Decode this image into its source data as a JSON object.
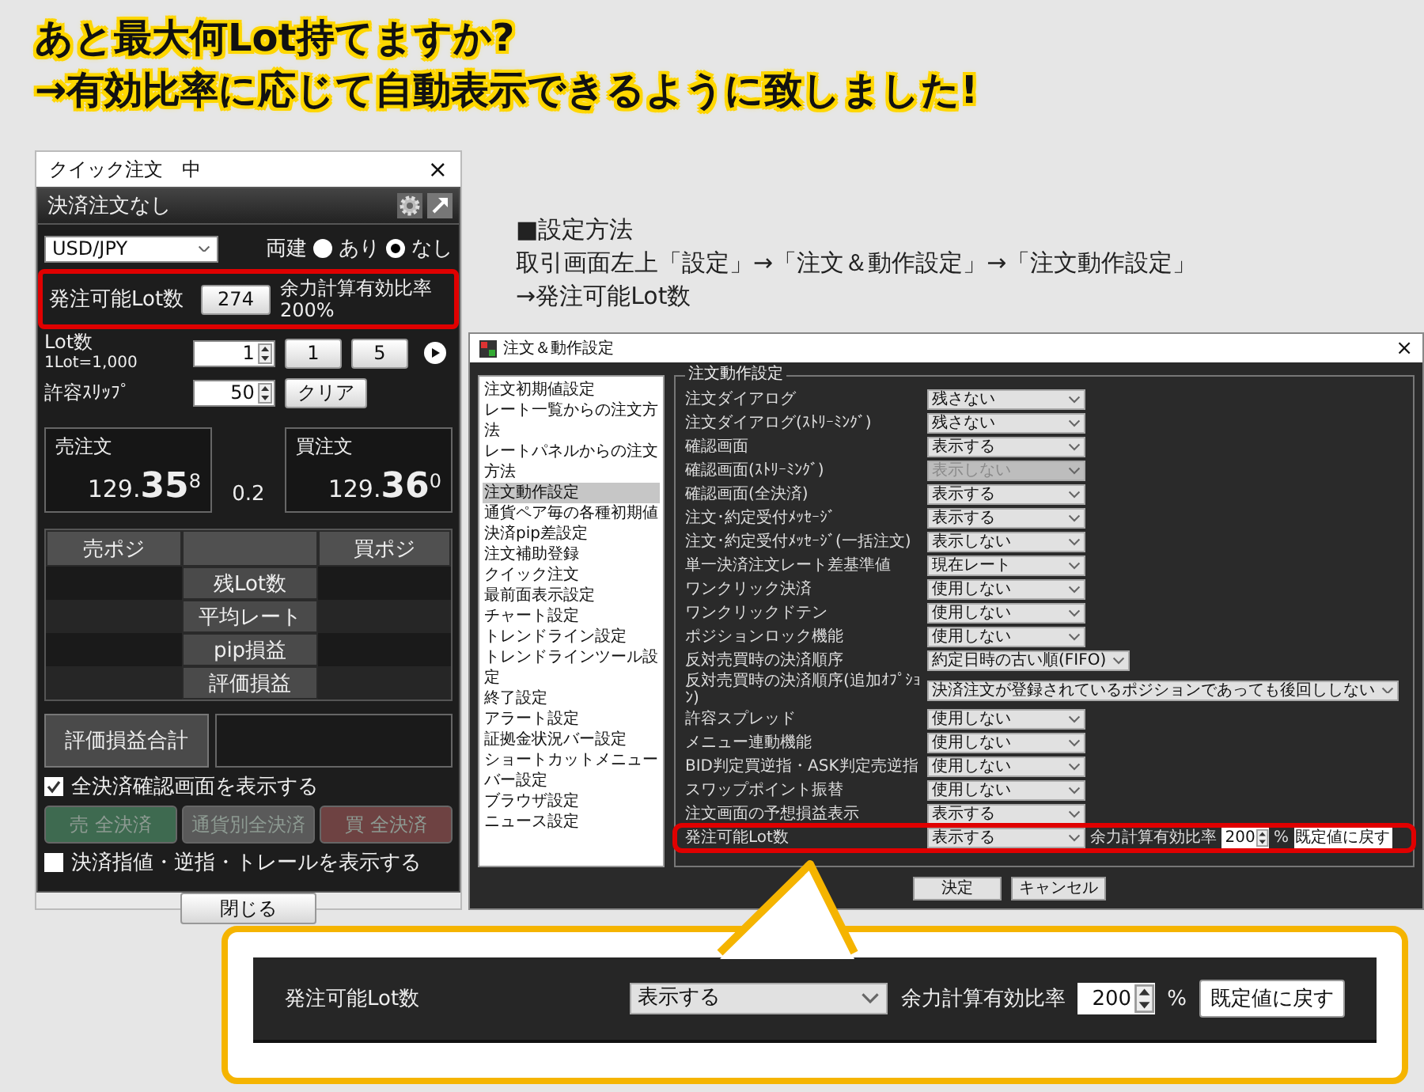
{
  "headline": {
    "lines": [
      "あと最大何Lot持てますか?",
      "→有効比率に応じて自動表示できるように致しました!"
    ]
  },
  "quick_order": {
    "title": "クイック注文　中",
    "close": "×",
    "header": "決済注文なし",
    "pair": "USD/JPY",
    "hedge": {
      "label": "両建",
      "options": [
        {
          "label": "あり",
          "selected": false
        },
        {
          "label": "なし",
          "selected": true
        }
      ]
    },
    "available_lots": {
      "label": "発注可能Lot数",
      "value": "274",
      "ratio_label": "余力計算有効比率",
      "ratio_value": "200%",
      "highlighted": true
    },
    "lot": {
      "label": "Lot数",
      "unit": "1Lot=1,000",
      "value": "1",
      "presets": [
        "1",
        "5"
      ]
    },
    "slippage": {
      "label": "許容ｽﾘｯﾌﾟ",
      "value": "50",
      "button": "クリア"
    },
    "sell": {
      "label": "売注文",
      "price": "129.**35**$^{8}$"
    },
    "spread": "0.2",
    "buy": {
      "label": "買注文",
      "price": "129.**36**$^{0}$"
    },
    "positions": {
      "columns": [
        "売ポジ",
        "買ポジ"
      ],
      "rows": [
        "残Lot数",
        "平均レート",
        "pip損益",
        "評価損益"
      ]
    },
    "total": {
      "label": "評価損益合計"
    },
    "confirm_check": {
      "label": "全決済確認画面を表示する",
      "checked": true
    },
    "close_buttons": [
      {
        "label": "売 全決済",
        "kind": "sell",
        "disabled": true
      },
      {
        "label": "通貨別全決済",
        "kind": "pair",
        "disabled": true
      },
      {
        "label": "買 全決済",
        "kind": "buy",
        "disabled": true
      }
    ],
    "order_check": {
      "label": "決済指値・逆指・トレールを表示する",
      "checked": false
    },
    "close_button": "閉じる"
  },
  "instructions": [
    "■設定方法",
    "取引画面左上「設定」→「注文＆動作設定」→「注文動作設定」",
    "→発注可能Lot数"
  ],
  "settings_dialog": {
    "title": "注文＆動作設定",
    "close": "×",
    "menu": [
      {
        "label": "注文初期値設定",
        "selected": false
      },
      {
        "label": "レート一覧からの注文方法",
        "selected": false
      },
      {
        "label": "レートパネルからの注文方法",
        "selected": false
      },
      {
        "label": "注文動作設定",
        "selected": true
      },
      {
        "label": "通貨ペア毎の各種初期値",
        "selected": false
      },
      {
        "label": "決済pip差設定",
        "selected": false
      },
      {
        "label": "注文補助登録",
        "selected": false
      },
      {
        "label": "クイック注文",
        "selected": false
      },
      {
        "label": "最前面表示設定",
        "selected": false
      },
      {
        "label": "チャート設定",
        "selected": false
      },
      {
        "label": "トレンドライン設定",
        "selected": false
      },
      {
        "label": "トレンドラインツール設定",
        "selected": false
      },
      {
        "label": "終了設定",
        "selected": false
      },
      {
        "label": "アラート設定",
        "selected": false
      },
      {
        "label": "証拠金状況バー設定",
        "selected": false
      },
      {
        "label": "ショートカットメニューバー設定",
        "selected": false
      },
      {
        "label": "ブラウザ設定",
        "selected": false
      },
      {
        "label": "ニュース設定",
        "selected": false
      }
    ],
    "group_title": "注文動作設定",
    "rows": [
      {
        "kind": "select",
        "label": "注文ダイアログ",
        "value": "残さない",
        "disabled": false,
        "highlighted": false
      },
      {
        "kind": "select",
        "label": "注文ダイアログ(ｽﾄﾘｰﾐﾝｸﾞ)",
        "value": "残さない",
        "disabled": false,
        "highlighted": false
      },
      {
        "kind": "select",
        "label": "確認画面",
        "value": "表示する",
        "disabled": false,
        "highlighted": false
      },
      {
        "kind": "select",
        "label": "確認画面(ｽﾄﾘｰﾐﾝｸﾞ)",
        "value": "表示しない",
        "disabled": true,
        "highlighted": false
      },
      {
        "kind": "select",
        "label": "確認画面(全決済)",
        "value": "表示する",
        "disabled": false,
        "highlighted": false
      },
      {
        "kind": "select",
        "label": "注文･約定受付ﾒｯｾｰｼﾞ",
        "value": "表示する",
        "disabled": false,
        "highlighted": false
      },
      {
        "kind": "select",
        "label": "注文･約定受付ﾒｯｾｰｼﾞ(一括注文)",
        "value": "表示しない",
        "disabled": false,
        "highlighted": false
      },
      {
        "kind": "select",
        "label": "単一決済注文レート差基準値",
        "value": "現在レート",
        "disabled": false,
        "highlighted": false
      },
      {
        "kind": "select",
        "label": "ワンクリック決済",
        "value": "使用しない",
        "disabled": false,
        "highlighted": false
      },
      {
        "kind": "select",
        "label": "ワンクリックドテン",
        "value": "使用しない",
        "disabled": false,
        "highlighted": false
      },
      {
        "kind": "select",
        "label": "ポジションロック機能",
        "value": "使用しない",
        "disabled": false,
        "highlighted": false
      },
      {
        "kind": "select",
        "label": "反対売買時の決済順序",
        "value": "約定日時の古い順(FIFO)",
        "disabled": false,
        "highlighted": false
      },
      {
        "kind": "select",
        "label": "反対売買時の決済順序(追加ｵﾌﾟｼｮﾝ)",
        "value": "決済注文が登録されているポジションであっても後回ししない",
        "disabled": false,
        "highlighted": false
      },
      {
        "kind": "select",
        "label": "許容スプレッド",
        "value": "使用しない",
        "disabled": false,
        "highlighted": false
      },
      {
        "kind": "select",
        "label": "メニュー連動機能",
        "value": "使用しない",
        "disabled": false,
        "highlighted": false
      },
      {
        "kind": "select",
        "label": "BID判定買逆指・ASK判定売逆指",
        "value": "使用しない",
        "disabled": false,
        "highlighted": false
      },
      {
        "kind": "select",
        "label": "スワップポイント振替",
        "value": "使用しない",
        "disabled": false,
        "highlighted": false
      },
      {
        "kind": "select",
        "label": "注文画面の予想損益表示",
        "value": "表示する",
        "disabled": false,
        "highlighted": false
      },
      {
        "kind": "select_ratio",
        "label": "発注可能Lot数",
        "value": "表示する",
        "disabled": false,
        "highlighted": true,
        "ratio_label": "余力計算有効比率",
        "ratio_value": "200",
        "percent": "%",
        "reset": "既定値に戻す"
      }
    ],
    "buttons": [
      "決定",
      "キャンセル"
    ]
  },
  "callout": {
    "label": "発注可能Lot数",
    "value": "表示する",
    "ratio_label": "余力計算有効比率",
    "ratio_value": "200",
    "percent": "%",
    "reset": "既定値に戻す"
  }
}
